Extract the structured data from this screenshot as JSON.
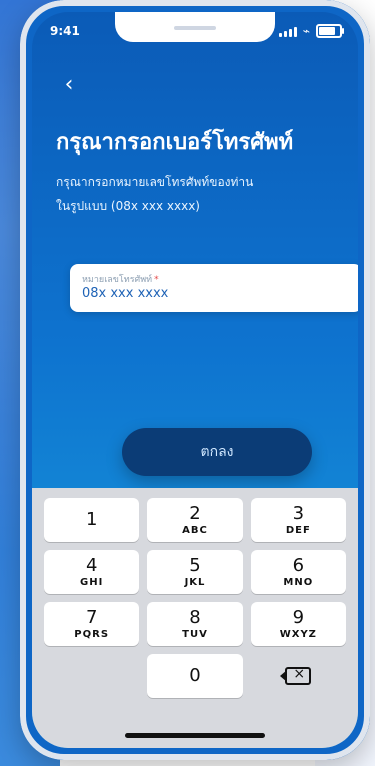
{
  "status_bar": {
    "time": "9:41"
  },
  "header": {
    "title": "กรุณากรอกเบอร์โทรศัพท์",
    "subtitle_line1": "กรุณากรอกหมายเลขโทรศัพท์ของท่าน",
    "subtitle_line2": "ในรูปแบบ (08x xxx xxxx)"
  },
  "phone_input": {
    "label": "หมายเลขโทรศัพท์",
    "required_mark": "*",
    "value": "08x xxx xxxx"
  },
  "actions": {
    "confirm_label": "ตกลง"
  },
  "keyboard": {
    "keys": [
      {
        "num": "1",
        "letters": ""
      },
      {
        "num": "2",
        "letters": "ABC"
      },
      {
        "num": "3",
        "letters": "DEF"
      },
      {
        "num": "4",
        "letters": "GHI"
      },
      {
        "num": "5",
        "letters": "JKL"
      },
      {
        "num": "6",
        "letters": "MNO"
      },
      {
        "num": "7",
        "letters": "PQRS"
      },
      {
        "num": "8",
        "letters": "TUV"
      },
      {
        "num": "9",
        "letters": "WXYZ"
      },
      {
        "num": "",
        "letters": ""
      },
      {
        "num": "0",
        "letters": ""
      },
      {
        "num": "",
        "letters": ""
      }
    ]
  },
  "icons": {
    "back_icon": "chevron-left",
    "wifi_icon": "wifi",
    "battery_icon": "battery",
    "backspace_icon": "backspace"
  }
}
